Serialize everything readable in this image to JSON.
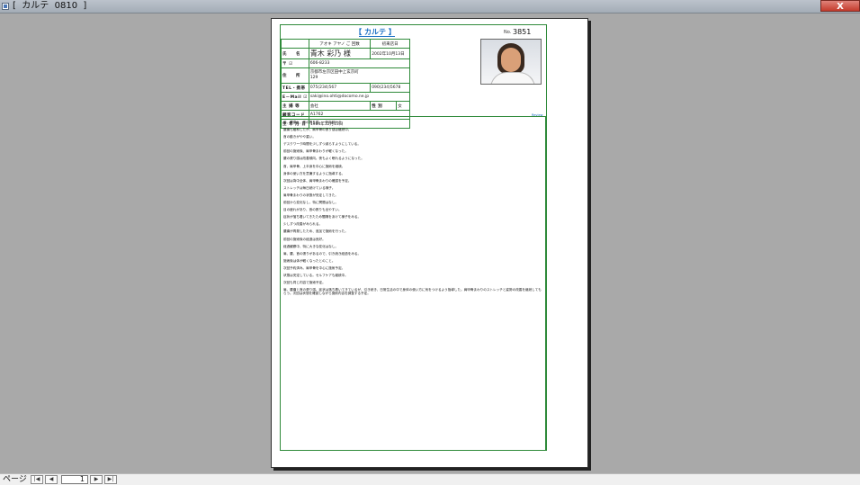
{
  "window": {
    "title": "[  カルテ  0810  ]",
    "close": "X"
  },
  "card": {
    "title": "【 カルテ 】",
    "no_label": "No.",
    "no_value": "3851",
    "furigana_header": "アオキ アヤノ ご 回数",
    "first_visit_header": "初来店日",
    "name_label": "氏　　名",
    "name": "青木 彩乃 様",
    "first_visit": "2002年10月13日",
    "postal_label": "〒",
    "postal": "606-8233",
    "address_label": "住　　所",
    "address_line1": "京都市左京区田中上玄京町",
    "address_line2": "129",
    "tel_label": "TEL・携帯",
    "tel": "075(234)567",
    "mobile": "090(234)5678",
    "email_label": "E－Mail",
    "email": "saki@ino.ohti@docomo.ne.jp",
    "job_label": "主 婦 等",
    "job": "会社",
    "gender_label": "性 別",
    "gender": "女",
    "customer_code_label": "顧客コード",
    "customer_code": "A1762",
    "birthday_label": "生 年 月 日",
    "birthday": "1984年12月13日",
    "reviews_link": "Review"
  },
  "notes": [
    "肩、腰痛と、首の張り感。一年半前から。",
    "腰痛も緩和したが、肩甲骨の張り感は継続中。",
    "首の動きがやや重い。",
    "デスクワーク時間を少しずつ減らすようにしている。",
    "前回の施術後、肩甲骨まわりが軽くなった。",
    "腰の張り感は改善傾向。夜もよく眠れるようになった。",
    "首、肩甲骨、上半身を中心に施術を継続。",
    "身体の使い方を意識するように指導する。",
    "次回は背中全体、肩甲骨まわりの確認を予定。",
    "ストレッチは毎日続けている様子。",
    "肩甲骨まわりの状態が安定してきた。",
    "前回から変化なし、特に問題はなし。",
    "目の疲れがあり、首の張りも出やすい。",
    "症状が落ち着いてきたため間隔をあけて様子をみる。",
    "少しずつ改善がみられる。",
    "腰痛が再発したため、追加で施術を行った。",
    "前回の施術後の経過は良好。",
    "経過観察中、特に大きな変化はなし。",
    "肩、腰、首の張りがあるので、引き続き経過をみる。",
    "施術後は体が軽くなったとのこと。",
    "次回予約済み。肩甲骨を中心に施術予定。",
    "状態は安定している。セルフケアも継続中。",
    "次回も同じ内容で施術予定。"
  ],
  "notes_last": "肩、腰痛と首の張り感。症状は落ち着いてきているが、引き続き、日常生活の中で身体の使い方に気をつけるよう指導した。肩甲骨まわりのストレッチと姿勢の改善を継続してもらう。次回は状態を確認しながら施術内容を調整する予定。",
  "statusbar": {
    "page_label": "ページ",
    "first": "|◀",
    "prev": "◀",
    "page": "1",
    "next": "▶",
    "last": "▶|"
  }
}
